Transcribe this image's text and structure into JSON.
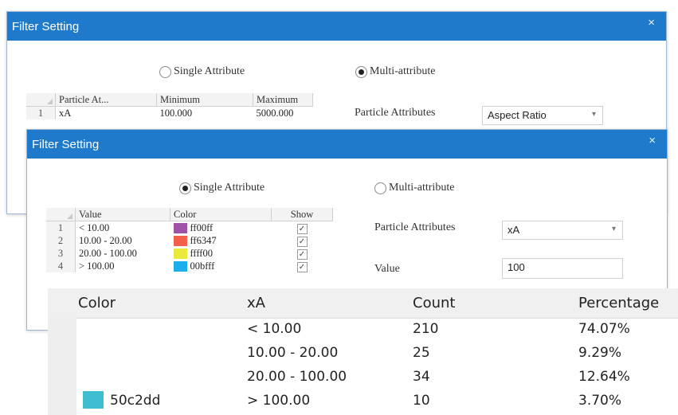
{
  "back_dialog": {
    "title": "Filter Setting",
    "close_label": "×",
    "radio_single": "Single Attribute",
    "radio_multi": "Multi-attribute",
    "selected_mode": "multi",
    "table": {
      "headers": [
        "Particle At...",
        "Minimum",
        "Maximum"
      ],
      "rows": [
        {
          "num": "1",
          "attr": "xA",
          "min": "100.000",
          "max": "5000.000"
        }
      ]
    },
    "particle_attributes_label": "Particle Attributes",
    "particle_attributes_value": "Aspect Ratio"
  },
  "front_dialog": {
    "title": "Filter Setting",
    "close_label": "×",
    "radio_single": "Single Attribute",
    "radio_multi": "Multi-attribute",
    "selected_mode": "single",
    "table": {
      "headers": [
        "Value",
        "Color",
        "Show"
      ],
      "rows": [
        {
          "num": "1",
          "value": "< 10.00",
          "color_hex": "#a052a8",
          "color_text": "ff00ff",
          "show": true
        },
        {
          "num": "2",
          "value": "10.00 - 20.00",
          "color_hex": "#f5604a",
          "color_text": "ff6347",
          "show": true
        },
        {
          "num": "3",
          "value": "20.00 - 100.00",
          "color_hex": "#eaea3a",
          "color_text": "ffff00",
          "show": true
        },
        {
          "num": "4",
          "value": "> 100.00",
          "color_hex": "#1aaeea",
          "color_text": "00bfff",
          "show": true
        }
      ]
    },
    "particle_attributes_label": "Particle Attributes",
    "particle_attributes_value": "xA",
    "value_label": "Value",
    "value_input": "100"
  },
  "results": {
    "headers": [
      "Color",
      "xA",
      "Count",
      "Percentage"
    ],
    "rows": [
      {
        "color_text": "",
        "color_hex": "",
        "range": "< 10.00",
        "count": "210",
        "percentage": "74.07%"
      },
      {
        "color_text": "",
        "color_hex": "",
        "range": "10.00 - 20.00",
        "count": "25",
        "percentage": "9.29%"
      },
      {
        "color_text": "",
        "color_hex": "",
        "range": "20.00 - 100.00",
        "count": "34",
        "percentage": "12.64%"
      },
      {
        "color_text": "50c2dd",
        "color_hex": "#3fbdd1",
        "range": "> 100.00",
        "count": "10",
        "percentage": "3.70%"
      }
    ]
  },
  "colors": {
    "titlebar": "#1f7acb"
  }
}
